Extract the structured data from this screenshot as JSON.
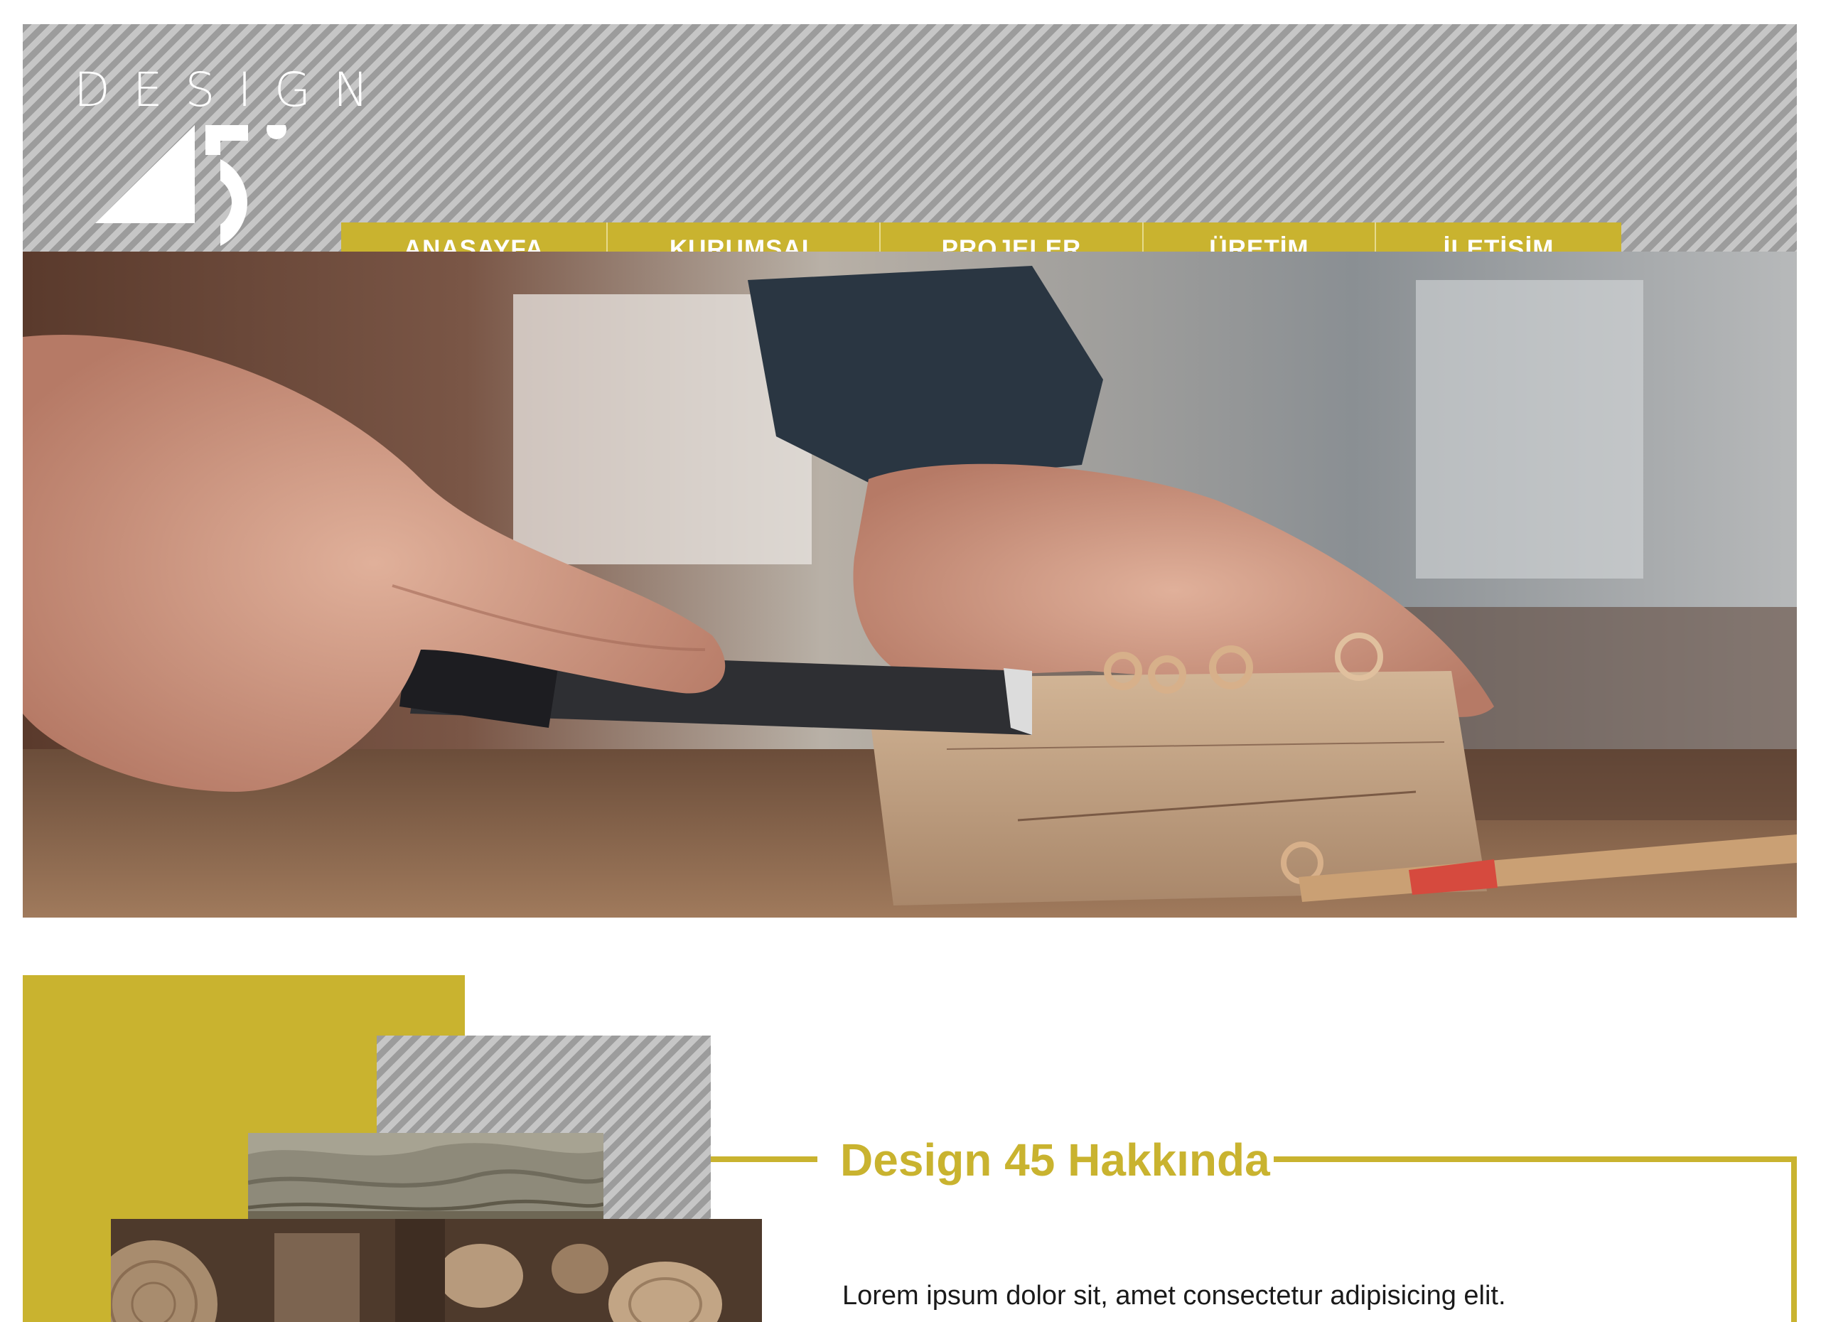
{
  "brand": {
    "wordmark": "DESIGN",
    "mark": "45°",
    "colors": {
      "accent": "#c9b32f",
      "stripe_dark": "#9c9c9c",
      "stripe_light": "#c6c6c6",
      "text": "#1a1a1a"
    }
  },
  "nav": {
    "items": [
      {
        "label": "ANASAYFA"
      },
      {
        "label": "KURUMSAL"
      },
      {
        "label": "PROJELER"
      },
      {
        "label": "ÜRETİM"
      },
      {
        "label": "İLETİŞİM"
      }
    ]
  },
  "hero": {
    "image": "carpenter-chiseling-wood-photo"
  },
  "about": {
    "title": "Design 45 Hakkında",
    "text": "Lorem ipsum dolor sit, amet consectetur adipisicing elit.",
    "images": [
      "wood-bark-photo",
      "stacked-logs-photo"
    ]
  }
}
